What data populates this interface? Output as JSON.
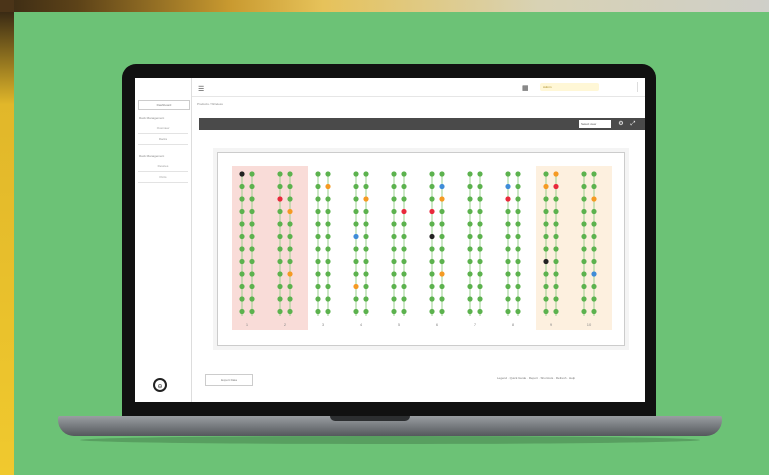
{
  "topbar": {
    "user_label": "Admin",
    "menu_icon": "menu-icon",
    "grid_icon": "grid-icon"
  },
  "breadcrumb": {
    "items": [
      "Products",
      "Wireless"
    ]
  },
  "sidebar": {
    "header": "Dashboard",
    "sections": [
      {
        "title": "Rack Management",
        "items": [
          "Overview",
          "Racks"
        ]
      },
      {
        "title": "Rack Management",
        "items": [
          "Devices",
          "Ports"
        ]
      }
    ]
  },
  "toolbar": {
    "view_select": "Select view",
    "settings_icon": "gear-icon",
    "expand_icon": "expand-icon"
  },
  "footer": {
    "export_button": "Export Data",
    "links": "Legend · Quick Guide · Report · Shortcuts · Refresh · Help"
  },
  "colors": {
    "background": "#6cc276",
    "port_green": "#5cb24e",
    "port_orange": "#f59a23",
    "port_red": "#e8293b",
    "port_blue": "#3f8cd8",
    "port_black": "#222222",
    "zone_red": "#f9dcd8",
    "zone_peach": "#fdf0df"
  },
  "board": {
    "columns": [
      {
        "label": "1",
        "zone": "red",
        "dots": [
          [
            "black",
            "g",
            "g",
            "g",
            "g",
            "g",
            "g",
            "g",
            "g",
            "g",
            "g",
            "g"
          ],
          [
            "g",
            "g",
            "g",
            "g",
            "g",
            "g",
            "g",
            "g",
            "g",
            "g",
            "g",
            "g"
          ]
        ]
      },
      {
        "label": "2",
        "zone": "red",
        "dots": [
          [
            "g",
            "g",
            "red",
            "g",
            "g",
            "g",
            "g",
            "g",
            "g",
            "g",
            "g",
            "g"
          ],
          [
            "g",
            "g",
            "g",
            "orange",
            "g",
            "g",
            "g",
            "g",
            "orange",
            "g",
            "g",
            "g"
          ]
        ]
      },
      {
        "label": "3",
        "zone": "none",
        "dots": [
          [
            "g",
            "g",
            "g",
            "g",
            "g",
            "g",
            "g",
            "g",
            "g",
            "g",
            "g",
            "g"
          ],
          [
            "g",
            "orange",
            "g",
            "g",
            "g",
            "g",
            "g",
            "g",
            "g",
            "g",
            "g",
            "g"
          ]
        ]
      },
      {
        "label": "4",
        "zone": "none",
        "dots": [
          [
            "g",
            "g",
            "g",
            "g",
            "g",
            "blue",
            "g",
            "g",
            "g",
            "orange",
            "g",
            "g"
          ],
          [
            "g",
            "g",
            "orange",
            "g",
            "g",
            "g",
            "g",
            "g",
            "g",
            "g",
            "g",
            "g"
          ]
        ]
      },
      {
        "label": "5",
        "zone": "none",
        "dots": [
          [
            "g",
            "g",
            "g",
            "g",
            "g",
            "g",
            "g",
            "g",
            "g",
            "g",
            "g",
            "g"
          ],
          [
            "g",
            "g",
            "g",
            "red",
            "g",
            "g",
            "g",
            "g",
            "g",
            "g",
            "g",
            "g"
          ]
        ]
      },
      {
        "label": "6",
        "zone": "none",
        "dots": [
          [
            "g",
            "g",
            "g",
            "red",
            "g",
            "black",
            "g",
            "g",
            "g",
            "g",
            "g",
            "g"
          ],
          [
            "g",
            "blue",
            "orange",
            "g",
            "g",
            "g",
            "g",
            "g",
            "orange",
            "g",
            "g",
            "g"
          ]
        ]
      },
      {
        "label": "7",
        "zone": "none",
        "dots": [
          [
            "g",
            "g",
            "g",
            "g",
            "g",
            "g",
            "g",
            "g",
            "g",
            "g",
            "g",
            "g"
          ],
          [
            "g",
            "g",
            "g",
            "g",
            "g",
            "g",
            "g",
            "g",
            "g",
            "g",
            "g",
            "g"
          ]
        ]
      },
      {
        "label": "8",
        "zone": "none",
        "dots": [
          [
            "g",
            "blue",
            "red",
            "g",
            "g",
            "g",
            "g",
            "g",
            "g",
            "g",
            "g",
            "g"
          ],
          [
            "g",
            "g",
            "g",
            "g",
            "g",
            "g",
            "g",
            "g",
            "g",
            "g",
            "g",
            "g"
          ]
        ]
      },
      {
        "label": "9",
        "zone": "peach",
        "dots": [
          [
            "g",
            "orange",
            "g",
            "g",
            "g",
            "g",
            "g",
            "black",
            "g",
            "g",
            "g",
            "g"
          ],
          [
            "orange",
            "red",
            "g",
            "g",
            "g",
            "g",
            "g",
            "g",
            "g",
            "g",
            "g",
            "g"
          ]
        ]
      },
      {
        "label": "10",
        "zone": "peach",
        "dots": [
          [
            "g",
            "g",
            "g",
            "g",
            "g",
            "g",
            "g",
            "g",
            "g",
            "g",
            "g",
            "g"
          ],
          [
            "g",
            "g",
            "orange",
            "g",
            "g",
            "g",
            "g",
            "g",
            "blue",
            "g",
            "g",
            "g"
          ]
        ]
      }
    ]
  }
}
